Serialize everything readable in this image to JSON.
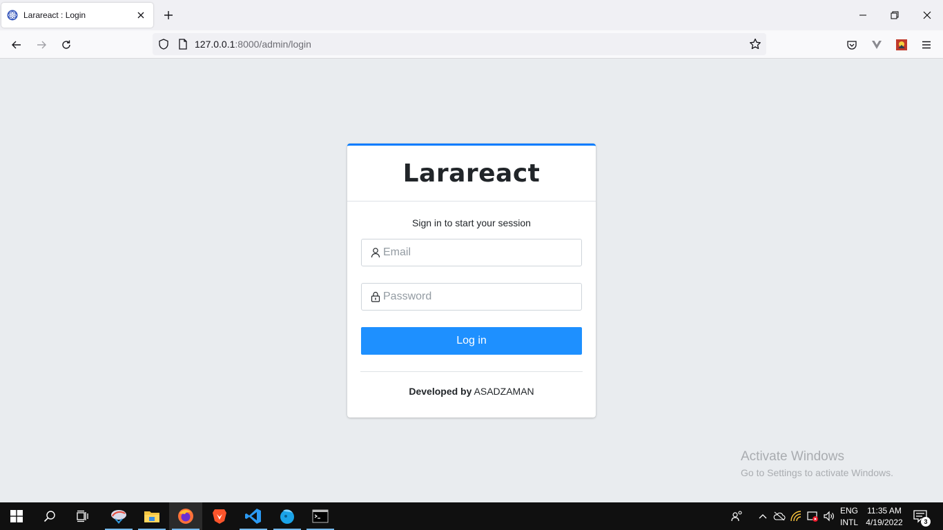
{
  "browser": {
    "tab": {
      "title": "Larareact : Login",
      "favicon": "react-atom-icon"
    },
    "url": {
      "host": "127.0.0.1",
      "rest": ":8000/admin/login"
    }
  },
  "login": {
    "brand": "Larareact",
    "message": "Sign in to start your session",
    "email_placeholder": "Email",
    "password_placeholder": "Password",
    "button_label": "Log in",
    "footer_bold": "Developed by",
    "footer_name": "ASADZAMAN"
  },
  "watermark": {
    "line1": "Activate Windows",
    "line2": "Go to Settings to activate Windows."
  },
  "taskbar": {
    "language_top": "ENG",
    "language_bottom": "INTL",
    "time": "11:35 AM",
    "date": "4/19/2022",
    "notification_count": "3"
  },
  "colors": {
    "accent": "#007bff",
    "button": "#1e90ff",
    "page_background": "#e9ecef",
    "taskbar": "#101010"
  }
}
